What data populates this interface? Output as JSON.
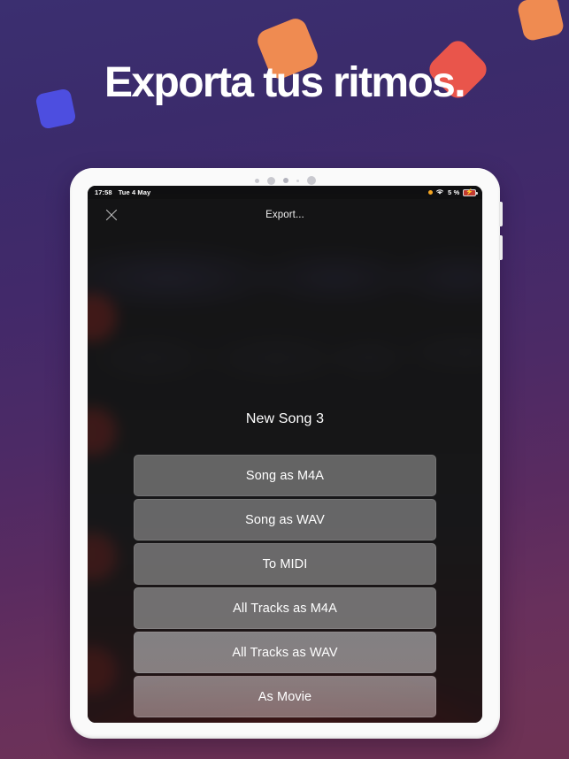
{
  "poster": {
    "headline": "Exporta tus ritmos.",
    "colors": {
      "bg_top": "#3b2f70",
      "bg_bottom": "#6e3254",
      "orange": "#ef8b51",
      "red": "#e9554b",
      "blue": "#4d4ee0"
    },
    "shapes": [
      {
        "name": "orange-square-top-right",
        "color": "#ef8b51"
      },
      {
        "name": "orange-square-center",
        "color": "#ef8b51"
      },
      {
        "name": "red-diamond",
        "color": "#e9554b"
      },
      {
        "name": "blue-square",
        "color": "#4d4ee0"
      }
    ]
  },
  "device": {
    "name": "tablet",
    "sensor_dots": 5
  },
  "status_bar": {
    "time": "17:58",
    "date": "Tue 4 May",
    "recording_indicator": "orange-dot",
    "wifi": "wifi-icon",
    "battery_percent": "5 %",
    "battery_state": "charging"
  },
  "nav_bar": {
    "close_icon": "close-icon",
    "title": "Export..."
  },
  "export_sheet": {
    "song_title": "New Song 3",
    "options": [
      {
        "label": "Song as M4A"
      },
      {
        "label": "Song as WAV"
      },
      {
        "label": "To MIDI"
      },
      {
        "label": "All Tracks as M4A"
      },
      {
        "label": "All Tracks as WAV"
      },
      {
        "label": "As Movie"
      }
    ]
  }
}
